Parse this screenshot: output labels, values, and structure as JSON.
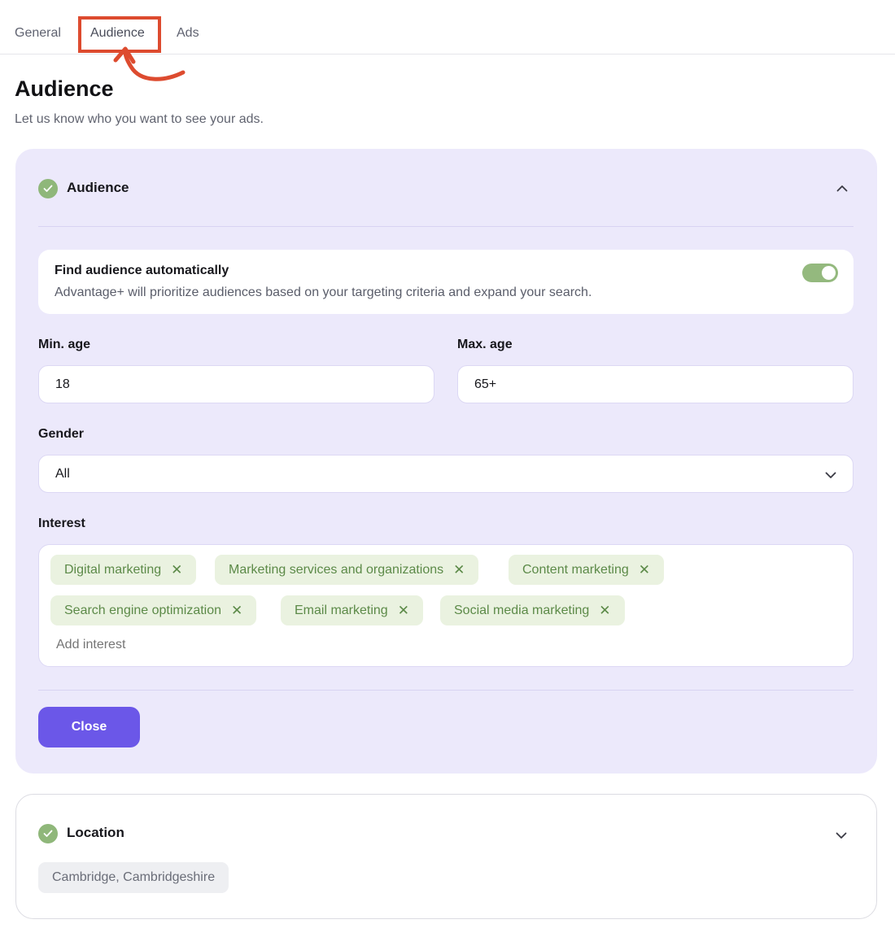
{
  "tabs": [
    {
      "label": "General"
    },
    {
      "label": "Audience",
      "active": true
    },
    {
      "label": "Ads"
    }
  ],
  "annotation": {
    "highlight_color": "#dd4b2f",
    "target": "Audience tab"
  },
  "page": {
    "title": "Audience",
    "subtitle": "Let us know who you want to see your ads."
  },
  "audience_panel": {
    "title": "Audience",
    "status_icon": "check-icon",
    "expanded": true,
    "auto": {
      "title": "Find audience automatically",
      "description": "Advantage+ will prioritize audiences based on your targeting criteria and expand your search.",
      "enabled": true
    },
    "min_age": {
      "label": "Min. age",
      "value": "18"
    },
    "max_age": {
      "label": "Max. age",
      "value": "65+"
    },
    "gender": {
      "label": "Gender",
      "value": "All"
    },
    "interest": {
      "label": "Interest",
      "tags": [
        "Digital marketing",
        "Marketing services and organizations",
        "Content marketing",
        "Search engine optimization",
        "Email marketing",
        "Social media marketing"
      ],
      "placeholder": "Add interest"
    },
    "close_label": "Close"
  },
  "location_panel": {
    "title": "Location",
    "status_icon": "check-icon",
    "expanded": false,
    "value": "Cambridge, Cambridgeshire"
  },
  "colors": {
    "accent": "#6b57e8",
    "panel_bg": "#ece9fb",
    "success": "#8fb77a",
    "tag_bg": "#eaf2e0",
    "tag_text": "#5c8a48"
  }
}
